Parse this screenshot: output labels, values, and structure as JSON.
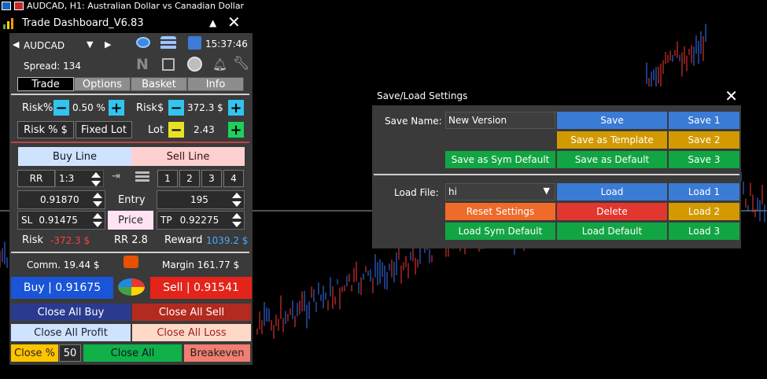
{
  "window": {
    "chart_title": "AUDCAD, H1:  Australian Dollar vs Canadian Dollar"
  },
  "dashboard": {
    "title": "Trade Dashboard_V6.83",
    "symbol": "AUDCAD",
    "time": "15:37:46",
    "spread": "Spread: 134",
    "tabs": [
      "Trade",
      "Options",
      "Basket",
      "Info"
    ],
    "risk_pct_label": "Risk%",
    "risk_pct_value": "0.50 %",
    "risk_usd_label": "Risk$",
    "risk_usd_value": "372.3 $",
    "risk_mode_label": "Risk % $",
    "fixed_lot_label": "Fixed Lot",
    "lot_label": "Lot",
    "lot_value": "2.43",
    "buy_line": "Buy Line",
    "sell_line": "Sell Line",
    "rr_label": "RR",
    "rr_value": "1:3",
    "rr_choices": [
      "1",
      "2",
      "3",
      "4"
    ],
    "entry_price": "0.91870",
    "entry_label": "Entry",
    "entry_points": "195",
    "sl_label": "SL",
    "sl_value": "0.91475",
    "price_label": "Price",
    "tp_label": "TP",
    "tp_value": "0.92275",
    "risk_label": "Risk",
    "risk_value": "-372.3 $",
    "rr_ratio": "RR 2.8",
    "reward_label": "Reward",
    "reward_value": "1039.2 $",
    "comm": "Comm. 19.44 $",
    "margin": "Margin 161.77 $",
    "buy_button": "Buy  |  0.91675",
    "sell_button": "Sell  |  0.91541",
    "close_all_buy": "Close All Buy",
    "close_all_sell": "Close All Sell",
    "close_all_profit": "Close All Profit",
    "close_all_loss": "Close All Loss",
    "close_pct": "Close %",
    "close_pct_value": "50",
    "close_all": "Close All",
    "breakeven": "Breakeven"
  },
  "save_load": {
    "title": "Save/Load Settings",
    "save_name_label": "Save Name:",
    "save_name_value": "New Version",
    "save": "Save",
    "save1": "Save 1",
    "save_as_template": "Save as Template",
    "save2": "Save 2",
    "save_as_sym_default": "Save as Sym Default",
    "save_as_default": "Save as Default",
    "save3": "Save 3",
    "load_file_label": "Load File:",
    "load_file_value": "hi",
    "load": "Load",
    "load1": "Load 1",
    "reset_settings": "Reset Settings",
    "delete": "Delete",
    "load2": "Load 2",
    "load_sym_default": "Load Sym Default",
    "load_default": "Load Default",
    "load3": "Load 3"
  },
  "colors": {
    "bull": "#3a78ff",
    "bear": "#ff3a3a",
    "background": "#000000"
  }
}
